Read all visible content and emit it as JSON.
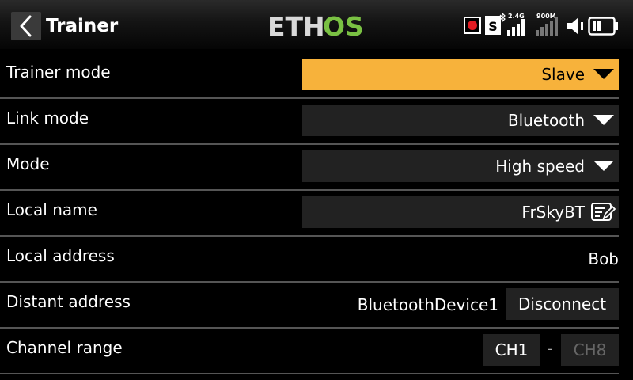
{
  "header": {
    "title": "Trainer",
    "logo_text_main": "ETH",
    "logo_text_accent": "OS",
    "logo_color": "#d8d8d8",
    "logo_accent_color": "#7ac143",
    "status": {
      "record_icon": "record-dot-icon",
      "bluetooth_badge": "S",
      "band_label": "2.4G",
      "freq_label": "900M",
      "volume_icon": "speaker-muted-icon",
      "battery_icon": "battery-icon"
    }
  },
  "rows": {
    "trainer_mode": {
      "label": "Trainer mode",
      "value": "Slave"
    },
    "link_mode": {
      "label": "Link mode",
      "value": "Bluetooth"
    },
    "mode": {
      "label": "Mode",
      "value": "High speed"
    },
    "local_name": {
      "label": "Local name",
      "value": "FrSkyBT"
    },
    "local_address": {
      "label": "Local address",
      "value": "Bob"
    },
    "distant_address": {
      "label": "Distant address",
      "value": "BluetoothDevice1",
      "button": "Disconnect"
    },
    "channel_range": {
      "label": "Channel range",
      "from": "CH1",
      "separator": "-",
      "to": "CH8"
    }
  },
  "colors": {
    "accent": "#f7b23b",
    "field_bg": "#222222",
    "separator": "#555555"
  }
}
